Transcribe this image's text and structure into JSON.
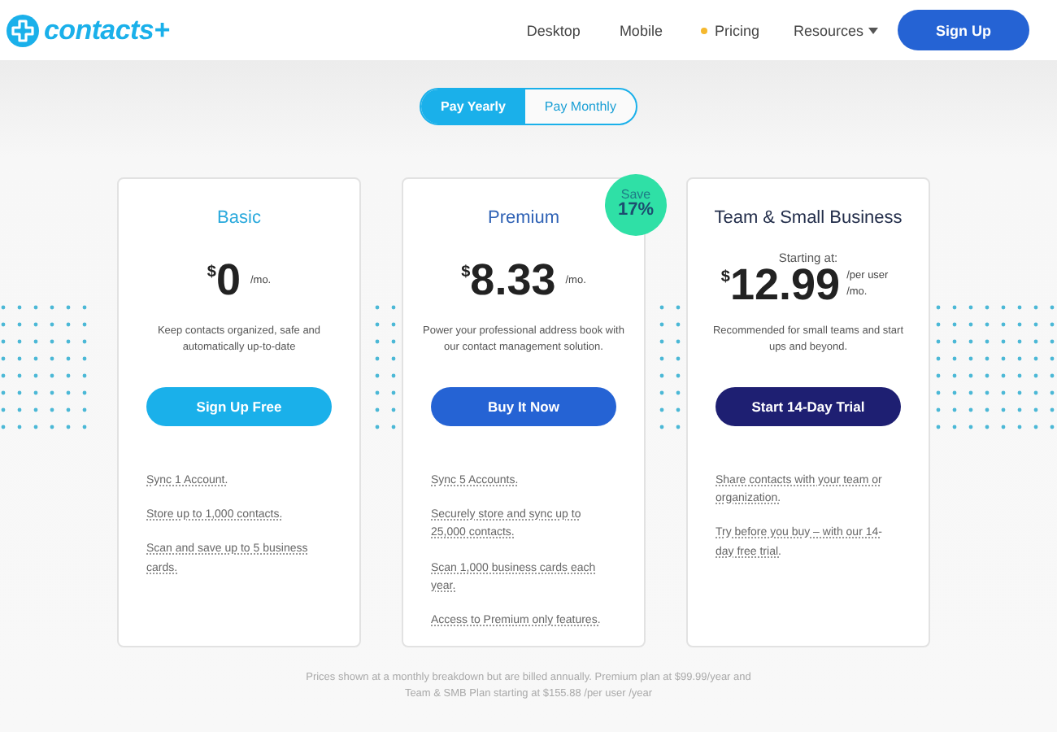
{
  "header": {
    "logo": "contacts+",
    "nav": [
      {
        "label": "Desktop",
        "kind": "plain"
      },
      {
        "label": "Mobile",
        "kind": "plain"
      },
      {
        "label": "Pricing",
        "kind": "dot"
      },
      {
        "label": "Resources",
        "kind": "menu"
      }
    ],
    "signup": "Sign Up"
  },
  "billing_toggle": [
    {
      "label": "Pay Yearly",
      "selected": true
    },
    {
      "label": "Pay Monthly",
      "selected": false
    }
  ],
  "plans": [
    {
      "name": "Basic",
      "kind": "basic",
      "currency": "$",
      "amount": "0",
      "unit": "/mo.",
      "description": "Keep contacts organized, safe and automatically up-to-date",
      "button": "Sign Up Free",
      "features": [
        "Sync 1 Account.",
        "Store up to 1,000 contacts.",
        "Scan and save up to 5 business cards."
      ]
    },
    {
      "name": "Premium",
      "kind": "premium",
      "badge": {
        "line_1": "Save",
        "line_2": "17%"
      },
      "currency": "$",
      "amount": "8.33",
      "unit": "/mo.",
      "description": "Power your professional address book with our contact management solution.",
      "button": "Buy It Now",
      "features": [
        "Sync 5 Accounts.",
        "Securely store and sync up to 25,000 contacts.",
        "Scan 1,000 business cards each year.",
        "Access to Premium only features."
      ]
    },
    {
      "name": "Team & Small Business",
      "kind": "team",
      "prefix": "Starting at:",
      "currency": "$",
      "amount": "12.99",
      "unit": "/per user /mo.",
      "description": "Recommended for small teams and start ups and beyond.",
      "button": "Start 14-Day Trial",
      "features": [
        "Share contacts with your team or organization.",
        "Try before you buy – with our 14-day free trial."
      ]
    }
  ],
  "footnote": "Prices shown at a monthly breakdown but are billed annually. Premium plan at $99.99/year and Team & SMB Plan starting at $155.88 /per user /year"
}
